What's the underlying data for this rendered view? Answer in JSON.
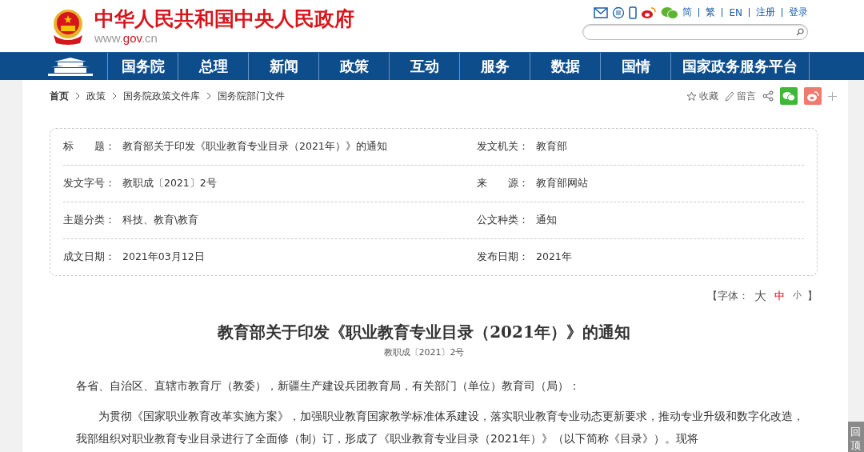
{
  "header": {
    "site_name": "中华人民共和国中央人民政府",
    "domain_prefix": "www.",
    "domain_main": "gov",
    "domain_suffix": ".cn",
    "links": [
      "简",
      "繁",
      "EN",
      "注册",
      "登录"
    ]
  },
  "nav": {
    "items": [
      "国务院",
      "总理",
      "新闻",
      "政策",
      "互动",
      "服务",
      "数据",
      "国情",
      "国家政务服务平台"
    ]
  },
  "breadcrumb": [
    "首页",
    "政策",
    "国务院政策文件库",
    "国务院部门文件"
  ],
  "tools": {
    "favorite": "收藏",
    "comment": "留言"
  },
  "info_table": {
    "rows": [
      [
        {
          "label": "标　　题：",
          "value": "教育部关于印发《职业教育专业目录（2021年）》的通知"
        },
        {
          "label": "发文机关：",
          "value": "教育部"
        }
      ],
      [
        {
          "label": "发文字号：",
          "value": "教职成〔2021〕2号"
        },
        {
          "label": "来　　源：",
          "value": "教育部网站"
        }
      ],
      [
        {
          "label": "主题分类：",
          "value": "科技、教育\\教育"
        },
        {
          "label": "公文种类：",
          "value": "通知"
        }
      ],
      [
        {
          "label": "成文日期：",
          "value": "2021年03月12日"
        },
        {
          "label": "发布日期：",
          "value": "2021年"
        }
      ]
    ]
  },
  "font_size": {
    "open": "【字体：",
    "options": [
      {
        "label": "大",
        "selected": false
      },
      {
        "label": "中",
        "selected": true
      },
      {
        "label": "小",
        "selected": false
      }
    ],
    "close": "】"
  },
  "article": {
    "title": "教育部关于印发《职业教育专业目录（2021年）》的通知",
    "doc_number": "教职成〔2021〕2号",
    "paragraphs": [
      {
        "kind": "salutation",
        "text": "各省、自治区、直辖市教育厅（教委），新疆生产建设兵团教育局，有关部门（单位）教育司（局）："
      },
      {
        "kind": "body",
        "text": "为贯彻《国家职业教育改革实施方案》，加强职业教育国家教学标准体系建设，落实职业教育专业动态更新要求，推动专业升级和数字化改造，我部组织对职业教育专业目录进行了全面修（制）订，形成了《职业教育专业目录（2021年）》（以下简称《目录》）。现将"
      }
    ]
  },
  "back_to_top": "回顶"
}
